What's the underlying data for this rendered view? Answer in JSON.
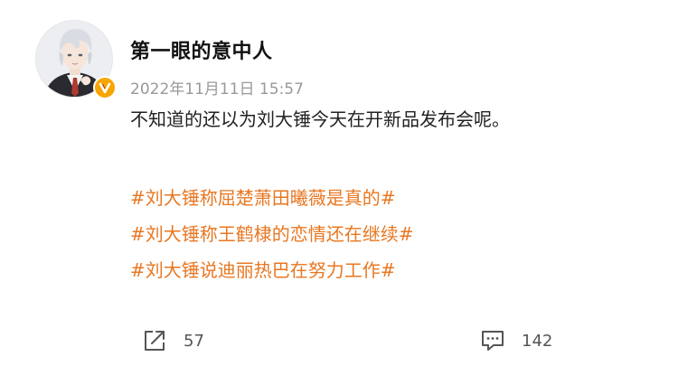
{
  "post": {
    "author": {
      "name": "第一眼的意中人",
      "verified": true,
      "badge_color": "#f7a500",
      "avatar_icon": "avatar-illustration"
    },
    "timestamp": "2022年11月11日 15:57",
    "text": "不知道的还以为刘大锤今天在开新品发布会呢。",
    "hashtags": [
      "#刘大锤称屈楚萧田曦薇是真的#",
      "#刘大锤称王鹤棣的恋情还在继续#",
      "#刘大锤说迪丽热巴在努力工作#"
    ],
    "hashtag_color": "#e87722",
    "actions": {
      "repost": {
        "icon": "share-icon",
        "count": "57"
      },
      "comment": {
        "icon": "comment-icon",
        "count": "142"
      }
    }
  }
}
